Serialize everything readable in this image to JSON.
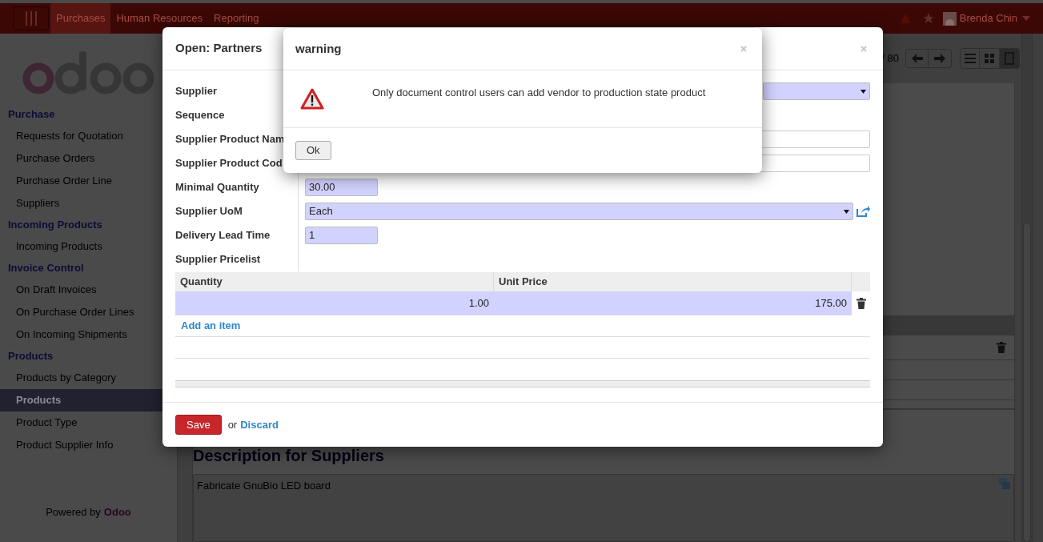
{
  "topbar": {
    "menu": [
      {
        "label": "Purchases",
        "selected": true
      },
      {
        "label": "Human Resources",
        "selected": false
      },
      {
        "label": "Reporting",
        "selected": false
      }
    ],
    "user": "Brenda Chin"
  },
  "sidebar": {
    "sections": [
      {
        "title": "Purchase",
        "items": [
          {
            "label": "Requests for Quotation",
            "selected": false
          },
          {
            "label": "Purchase Orders",
            "selected": false
          },
          {
            "label": "Purchase Order Line",
            "selected": false
          },
          {
            "label": "Suppliers",
            "selected": false
          }
        ]
      },
      {
        "title": "Incoming Products",
        "items": [
          {
            "label": "Incoming Products",
            "selected": false
          }
        ]
      },
      {
        "title": "Invoice Control",
        "items": [
          {
            "label": "On Draft Invoices",
            "selected": false
          },
          {
            "label": "On Purchase Order Lines",
            "selected": false
          },
          {
            "label": "On Incoming Shipments",
            "selected": false
          }
        ]
      },
      {
        "title": "Products",
        "items": [
          {
            "label": "Products by Category",
            "selected": false
          },
          {
            "label": "Products",
            "selected": true
          },
          {
            "label": "Product Type",
            "selected": false
          },
          {
            "label": "Product Supplier Info",
            "selected": false
          }
        ]
      }
    ],
    "footer": {
      "prefix": "Powered by",
      "brand": "Odoo"
    }
  },
  "main": {
    "pager": "/ 80",
    "views": [
      {
        "kind": "list",
        "selected": false
      },
      {
        "kind": "kanban",
        "selected": false
      },
      {
        "kind": "form",
        "selected": true
      }
    ],
    "section_title": "Description for Suppliers",
    "description": "Fabricate GnuBio LED board"
  },
  "dialog": {
    "title": "Open: Partners",
    "fields": [
      {
        "label": "Supplier",
        "kind": "select"
      },
      {
        "label": "Sequence",
        "kind": "none"
      },
      {
        "label": "Supplier Product Nam",
        "kind": "text"
      },
      {
        "label": "Supplier Product Cod",
        "kind": "text"
      },
      {
        "label": "Minimal Quantity",
        "kind": "short",
        "value": "30.00"
      },
      {
        "label": "Supplier UoM",
        "kind": "select",
        "value": "Each",
        "link": true
      },
      {
        "label": "Delivery Lead Time",
        "kind": "short",
        "value": "1"
      },
      {
        "label": "Supplier Pricelist",
        "kind": "none"
      }
    ],
    "table": {
      "columns": [
        "Quantity",
        "Unit Price"
      ],
      "rows": [
        {
          "cells": [
            "1.00",
            "175.00"
          ]
        }
      ],
      "add_link": "Add an item"
    },
    "save": "Save",
    "or": "or",
    "discard": "Discard"
  },
  "warning": {
    "title": "warning",
    "message": "Only document control users can add vendor to production state product",
    "button": "Ok"
  }
}
